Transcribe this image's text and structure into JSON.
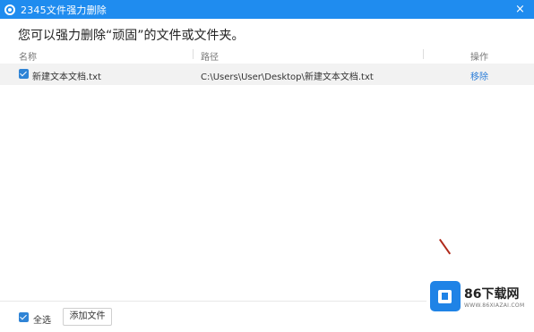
{
  "window": {
    "title": "2345文件强力删除",
    "close_icon": "×"
  },
  "headline": "您可以强力删除“顽固”的文件或文件夹。",
  "table": {
    "columns": [
      "名称",
      "路径",
      "操作"
    ],
    "rows": [
      {
        "name": "新建文本文档.txt",
        "path": "C:\\Users\\User\\Desktop\\新建文本文档.txt",
        "action": "移除"
      }
    ]
  },
  "footer": {
    "select_all": "全选",
    "add_file": "添加文件"
  },
  "watermark": {
    "title": "86下载网",
    "subtitle": "WWW.86XIAZAI.COM"
  },
  "colors": {
    "titlebar": "#1f8cef",
    "checkbox": "#2f84d6",
    "link": "#2a7dd8",
    "row_bg": "#f2f2f2"
  }
}
